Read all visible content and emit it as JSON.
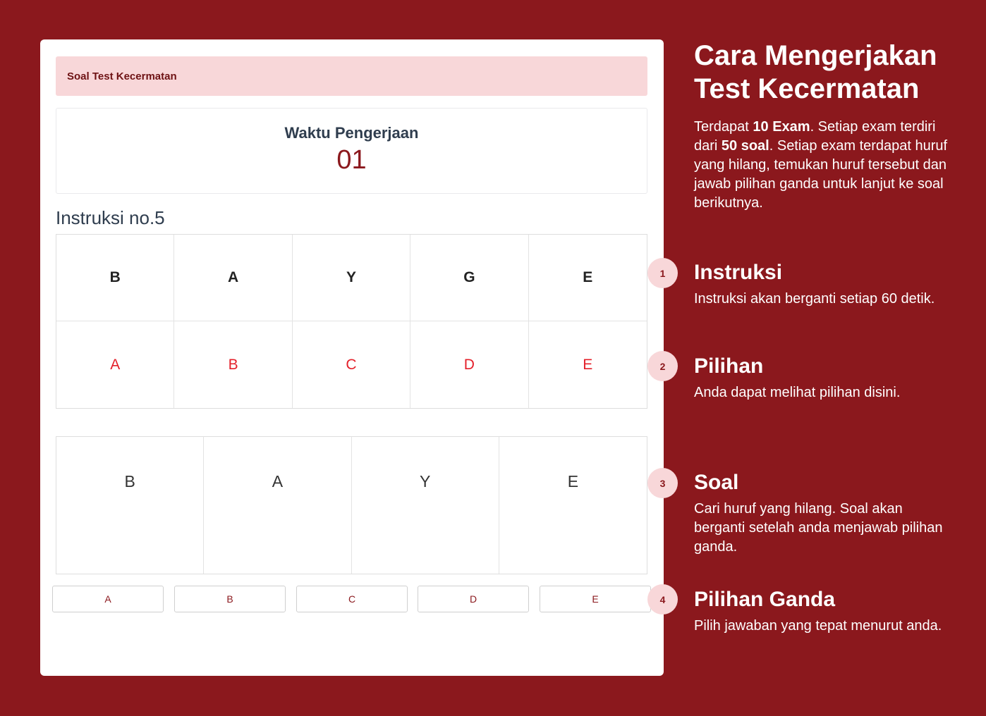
{
  "card": {
    "alert_title": "Soal Test Kecermatan",
    "timer_label": "Waktu Pengerjaan",
    "timer_value": "01",
    "instruction_title": "Instruksi no.5",
    "instruction_letters": [
      "B",
      "A",
      "Y",
      "G",
      "E"
    ],
    "instruction_options": [
      "A",
      "B",
      "C",
      "D",
      "E"
    ],
    "question_letters": [
      "B",
      "A",
      "Y",
      "E"
    ],
    "answer_buttons": [
      "A",
      "B",
      "C",
      "D",
      "E"
    ]
  },
  "side": {
    "title_line1": "Cara Mengerjakan",
    "title_line2": "Test Kecermatan",
    "desc": {
      "p1": "Terdapat ",
      "b1": "10 Exam",
      "p2": ". Setiap exam terdiri dari ",
      "b2": "50 soal",
      "p3": ". Setiap exam terdapat huruf yang hilang, temukan huruf tersebut dan jawab pilihan ganda untuk lanjut ke soal berikutnya."
    }
  },
  "steps": [
    {
      "number": "1",
      "title": "Instruksi",
      "desc": "Instruksi akan berganti setiap 60 detik."
    },
    {
      "number": "2",
      "title": "Pilihan",
      "desc": "Anda dapat melihat pilihan disini."
    },
    {
      "number": "3",
      "title": "Soal",
      "desc": "Cari huruf yang hilang. Soal akan berganti setelah anda menjawab pilihan ganda."
    },
    {
      "number": "4",
      "title": "Pilihan Ganda",
      "desc": "Pilih jawaban yang tepat menurut anda."
    }
  ],
  "colors": {
    "background": "#8b181d",
    "alert_bg": "#f8d7d9",
    "option_red": "#e4202a"
  }
}
